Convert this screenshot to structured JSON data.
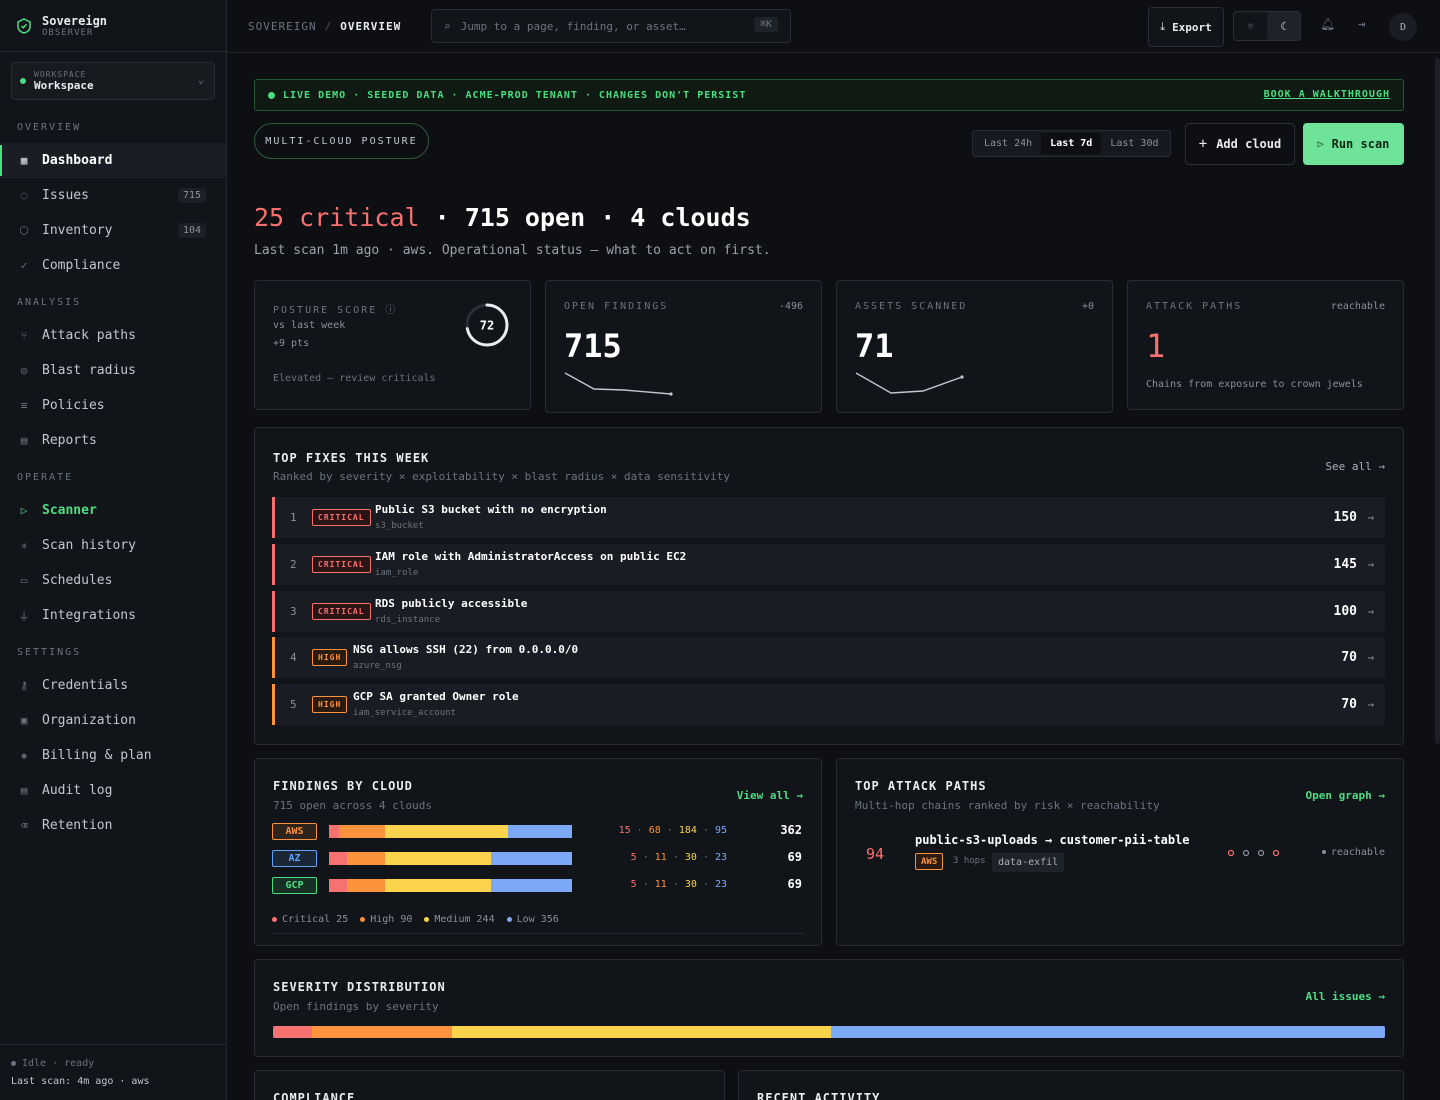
{
  "brand": {
    "name": "Sovereign",
    "sub": "OBSERVER"
  },
  "workspace": {
    "label": "WORKSPACE",
    "name": "Workspace"
  },
  "sidebar": {
    "sections": [
      {
        "title": "OVERVIEW",
        "items": [
          {
            "label": "Dashboard",
            "icon": "grid-icon",
            "badge": ""
          },
          {
            "label": "Issues",
            "icon": "alert-circle-icon",
            "badge": "715"
          },
          {
            "label": "Inventory",
            "icon": "box-icon",
            "badge": "104"
          },
          {
            "label": "Compliance",
            "icon": "check-icon",
            "badge": ""
          }
        ]
      },
      {
        "title": "ANALYSIS",
        "items": [
          {
            "label": "Attack paths",
            "icon": "branch-icon"
          },
          {
            "label": "Blast radius",
            "icon": "radar-icon"
          },
          {
            "label": "Policies",
            "icon": "list-icon"
          },
          {
            "label": "Reports",
            "icon": "document-icon"
          }
        ]
      },
      {
        "title": "OPERATE",
        "items": [
          {
            "label": "Scanner",
            "icon": "play-icon"
          },
          {
            "label": "Scan history",
            "icon": "sparkle-icon"
          },
          {
            "label": "Schedules",
            "icon": "calendar-icon"
          },
          {
            "label": "Integrations",
            "icon": "plug-icon"
          }
        ]
      },
      {
        "title": "SETTINGS",
        "items": [
          {
            "label": "Credentials",
            "icon": "key-icon"
          },
          {
            "label": "Organization",
            "icon": "building-icon"
          },
          {
            "label": "Billing & plan",
            "icon": "layers-icon"
          },
          {
            "label": "Audit log",
            "icon": "log-icon"
          },
          {
            "label": "Retention",
            "icon": "trash-icon"
          }
        ]
      }
    ],
    "footer": {
      "status": "Idle · ready",
      "last_scan_label": "Last scan:",
      "last_scan_value": "4m ago · aws"
    }
  },
  "topbar": {
    "crumb_root": "SOVEREIGN",
    "crumb_sep": "/",
    "crumb_current": "OVERVIEW",
    "search_placeholder": "Jump to a page, finding, or asset…",
    "search_kbd": "⌘K",
    "export_label": "Export",
    "avatar_initial": "D"
  },
  "banner": {
    "text": "LIVE DEMO · SEEDED DATA · ACME-PROD TENANT · CHANGES DON'T PERSIST",
    "link": "BOOK A WALKTHROUGH"
  },
  "header": {
    "pill": "MULTI-CLOUD POSTURE",
    "ranges": [
      "Last 24h",
      "Last 7d",
      "Last 30d"
    ],
    "range_selected": "Last 7d",
    "add_cloud": "Add cloud",
    "run_scan": "Run scan",
    "headline_critical": "25 critical",
    "headline_rest": " · 715 open · 4 clouds",
    "subline": "Last scan 1m ago · aws. Operational status — what to act on first."
  },
  "kpis": {
    "posture": {
      "label": "POSTURE SCORE",
      "line1": "vs last week",
      "line2": "+9 pts",
      "note": "Elevated — review criticals",
      "score": "72",
      "score_fraction": 0.72
    },
    "findings": {
      "label": "OPEN FINDINGS",
      "delta": "-496",
      "value": "715"
    },
    "assets": {
      "label": "ASSETS SCANNED",
      "delta": "+0",
      "value": "71"
    },
    "paths": {
      "label": "ATTACK PATHS",
      "tag": "reachable",
      "value": "1",
      "note": "Chains from exposure to crown jewels"
    }
  },
  "top_fixes": {
    "title": "TOP FIXES THIS WEEK",
    "subtitle": "Ranked by severity × exploitability × blast radius × data sensitivity",
    "see_all": "See all →",
    "items": [
      {
        "rank": "1",
        "severity": "CRITICAL",
        "title": "Public S3 bucket with no encryption",
        "type": "s3_bucket",
        "score": "150"
      },
      {
        "rank": "2",
        "severity": "CRITICAL",
        "title": "IAM role with AdministratorAccess on public EC2",
        "type": "iam_role",
        "score": "145"
      },
      {
        "rank": "3",
        "severity": "CRITICAL",
        "title": "RDS publicly accessible",
        "type": "rds_instance",
        "score": "100"
      },
      {
        "rank": "4",
        "severity": "HIGH",
        "title": "NSG allows SSH (22) from 0.0.0.0/0",
        "type": "azure_nsg",
        "score": "70"
      },
      {
        "rank": "5",
        "severity": "HIGH",
        "title": "GCP SA granted Owner role",
        "type": "iam_service_account",
        "score": "70"
      }
    ]
  },
  "findings_by_cloud": {
    "title": "FINDINGS BY CLOUD",
    "subtitle": "715 open across 4 clouds",
    "view_all": "View all →",
    "rows": [
      {
        "cloud": "AWS",
        "color": "#fb923c",
        "critical": "15",
        "high": "68",
        "medium": "184",
        "low": "95",
        "total": "362"
      },
      {
        "cloud": "AZ",
        "color": "#60a5fa",
        "critical": "5",
        "high": "11",
        "medium": "30",
        "low": "23",
        "total": "69"
      },
      {
        "cloud": "GCP",
        "color": "#4ade80",
        "critical": "5",
        "high": "11",
        "medium": "30",
        "low": "23",
        "total": "69"
      }
    ],
    "legend": [
      "Critical 25",
      "High 90",
      "Medium 244",
      "Low 356"
    ]
  },
  "attack_paths": {
    "title": "TOP ATTACK PATHS",
    "subtitle": "Multi-hop chains ranked by risk × reachability",
    "open_graph": "Open graph →",
    "item": {
      "risk": "94",
      "path": "public-s3-uploads → customer-pii-table",
      "cloud": "AWS",
      "hops": "3 hops",
      "tag": "data-exfil",
      "status": "reachable"
    }
  },
  "severity_distribution": {
    "title": "SEVERITY DISTRIBUTION",
    "subtitle": "Open findings by severity",
    "link": "All issues →",
    "values": {
      "critical": 25,
      "high": 90,
      "medium": 244,
      "low": 356
    }
  },
  "bottom": {
    "compliance": "COMPLIANCE",
    "activity": "RECENT ACTIVITY"
  },
  "colors": {
    "critical": "#f87171",
    "high": "#fb923c",
    "medium": "#fcd34d",
    "low": "#7da8f5",
    "accent": "#4ade80"
  }
}
